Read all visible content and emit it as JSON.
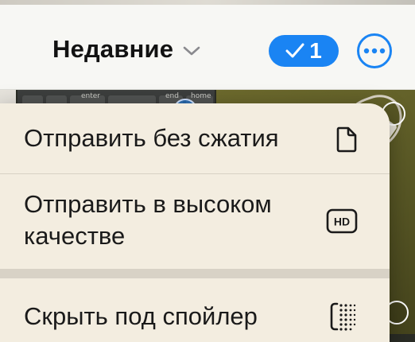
{
  "header": {
    "album_title": "Недавние",
    "selected_count": "1",
    "accent_color": "#1a84f3",
    "icons": {
      "album_chevron": "chevron-down-icon",
      "selected_check": "checkmark-icon",
      "more": "ellipsis-circle-icon"
    }
  },
  "background_photos": {
    "keyboard_keys": [
      "enter",
      "end",
      "home"
    ]
  },
  "menu": {
    "items": [
      {
        "label": "Отправить без сжатия",
        "icon": "document-icon"
      },
      {
        "label": "Отправить в высоком качестве",
        "icon": "hd-icon",
        "icon_text": "HD"
      },
      {
        "label": "Скрыть под спойлер",
        "icon": "spoiler-dots-icon"
      }
    ]
  }
}
